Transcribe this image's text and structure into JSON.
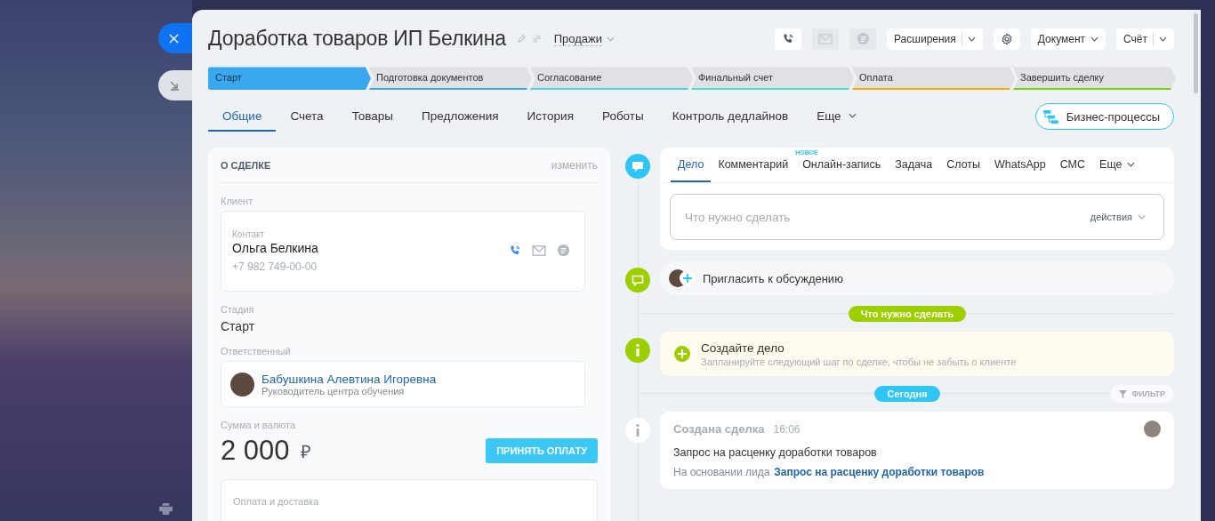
{
  "header": {
    "title": "Доработка товаров ИП Белкина",
    "category": "Продажи",
    "icon_buttons": [
      {
        "kind": "call",
        "disabled": false
      },
      {
        "kind": "mail",
        "disabled": true
      },
      {
        "kind": "chat",
        "disabled": true
      }
    ],
    "menu_buttons": [
      {
        "kind": "split",
        "label": "Расширения"
      },
      {
        "kind": "settings"
      },
      {
        "kind": "dropdown",
        "label": "Документ"
      },
      {
        "kind": "split",
        "label": "Счёт"
      }
    ]
  },
  "stages": [
    {
      "label": "Старт",
      "selected": true,
      "color": "#39a8ef"
    },
    {
      "label": "Подготовка документов",
      "selected": false,
      "color": "#39a8ef"
    },
    {
      "label": "Согласование",
      "selected": false,
      "color": "#55d0e0"
    },
    {
      "label": "Финальный счет",
      "selected": false,
      "color": "#47e4c2"
    },
    {
      "label": "Оплата",
      "selected": false,
      "color": "#ffa900"
    },
    {
      "label": "Завершить сделку",
      "selected": false,
      "color": "#7bd500"
    }
  ],
  "tabs": [
    {
      "label": "Общие",
      "selected": true
    },
    {
      "label": "Счета",
      "selected": false
    },
    {
      "label": "Товары",
      "selected": false
    },
    {
      "label": "Предложения",
      "selected": false
    },
    {
      "label": "История",
      "selected": false
    },
    {
      "label": "Роботы",
      "selected": false
    },
    {
      "label": "Контроль дедлайнов",
      "selected": false
    }
  ],
  "tabs_more": "Еще",
  "process_button": "Бизнес-процессы",
  "deal": {
    "title": "О СДЕЛКЕ",
    "edit": "изменить",
    "client_label": "Клиент",
    "contact": {
      "label": "Контакт",
      "name": "Ольга Белкина",
      "phone": "+7 982 749-00-00"
    },
    "stage_label": "Стадия",
    "stage_value": "Старт",
    "responsible_label": "Ответственный",
    "responsible": {
      "name": "Бабушкина Алевтина Игоревна",
      "position": "Руководитель центра обучения"
    },
    "sum_label": "Сумма и валюта",
    "amount": "2 000",
    "currency": "₽",
    "pay_button": "ПРИНЯТЬ ОПЛАТУ",
    "payment_label": "Оплата и доставка"
  },
  "timeline": {
    "composer": {
      "tabs": [
        {
          "label": "Дело",
          "selected": true
        },
        {
          "label": "Комментарий",
          "selected": false
        },
        {
          "label": "Онлайн-запись",
          "selected": false,
          "badge": "НОВОЕ"
        },
        {
          "label": "Задача",
          "selected": false
        },
        {
          "label": "Слоты",
          "selected": false
        },
        {
          "label": "WhatsApp",
          "selected": false
        },
        {
          "label": "СМС",
          "selected": false
        }
      ],
      "more": "Еще",
      "placeholder": "Что нужно сделать",
      "actions": "действия"
    },
    "invite": "Пригласить к обсуждению",
    "todo_separator": "Что нужно сделать",
    "create": {
      "title": "Создайте дело",
      "hint": "Запланируйте следующий шаг по сделке, чтобы не забыть о клиенте"
    },
    "today_separator": "Сегодня",
    "filter": "ФИЛЬТР",
    "event": {
      "title": "Создана сделка",
      "time": "16:06",
      "text": "Запрос на расценку доработки товаров",
      "prefix": "На основании лида",
      "link": "Запрос на расценку доработки товаров"
    }
  }
}
